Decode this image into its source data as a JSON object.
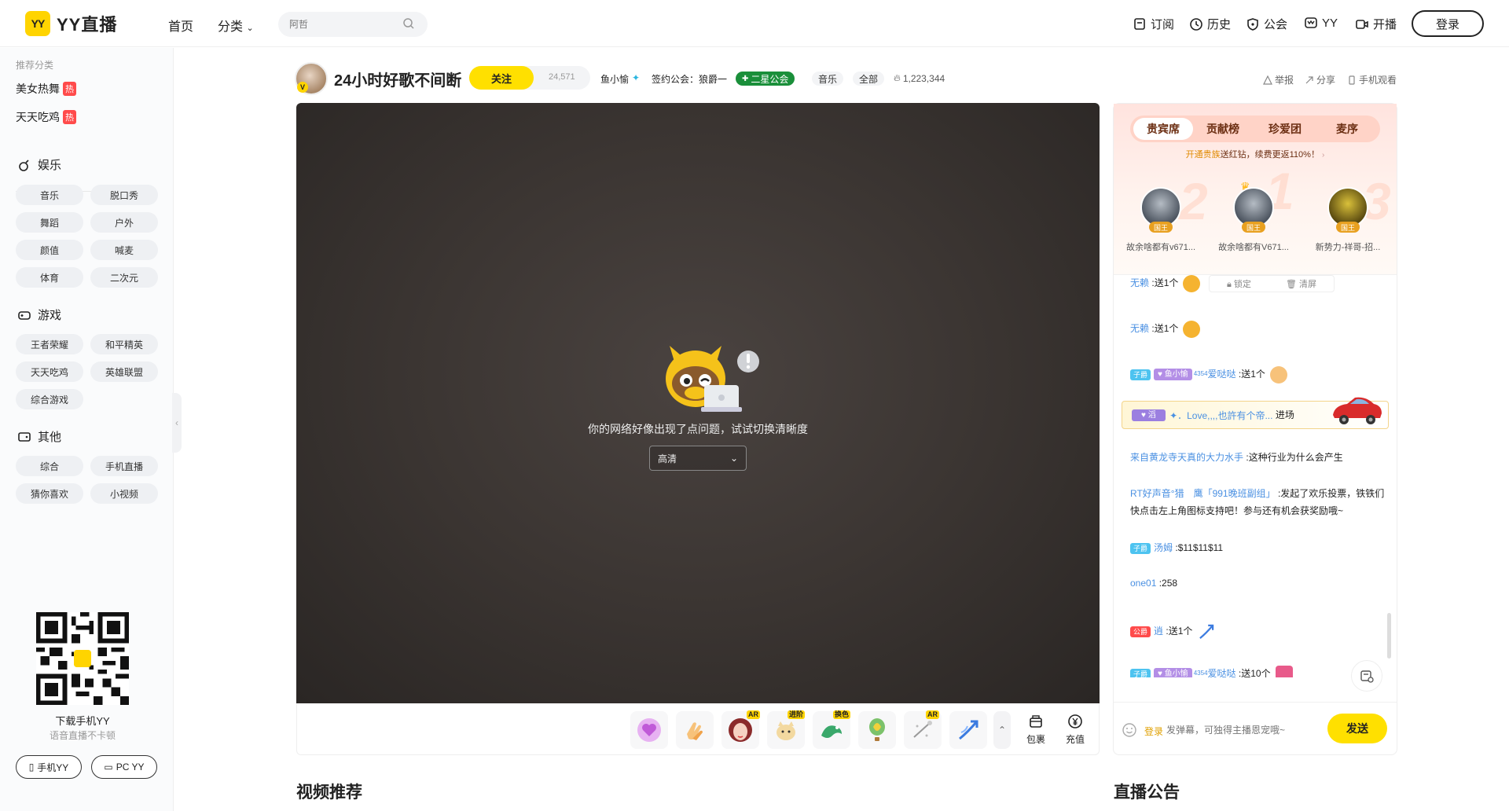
{
  "header": {
    "logo_mark": "YY",
    "logo_text": "YY直播",
    "nav": [
      "首页",
      "分类"
    ],
    "search_placeholder": "阿哲",
    "right_items": [
      "订阅",
      "历史",
      "公会",
      "YY",
      "开播"
    ],
    "login": "登录"
  },
  "sidebar": {
    "recommend_title": "推荐分类",
    "hot_items": [
      {
        "label": "美女热舞",
        "badge": "热"
      },
      {
        "label": "天天吃鸡",
        "badge": "热"
      }
    ],
    "sections": [
      {
        "title": "娱乐",
        "items": [
          "音乐",
          "脱口秀",
          "舞蹈",
          "户外",
          "颜值",
          "喊麦",
          "体育",
          "二次元"
        ]
      },
      {
        "title": "游戏",
        "items": [
          "王者荣耀",
          "和平精英",
          "天天吃鸡",
          "英雄联盟",
          "综合游戏"
        ]
      },
      {
        "title": "其他",
        "items": [
          "综合",
          "手机直播",
          "猜你喜欢",
          "小视频"
        ]
      }
    ],
    "download_title": "下载手机YY",
    "download_sub": "语音直播不卡顿",
    "buttons": [
      "手机YY",
      "PC YY"
    ]
  },
  "room": {
    "title": "24小时好歌不间断",
    "follow": "关注",
    "follow_count": "24,571",
    "anchor": "鱼小愉",
    "guild": "签约公会：狼爵一",
    "guild_tag": "二星公会",
    "tags": [
      "音乐",
      "全部"
    ],
    "heat": "1,223,344",
    "actions": [
      "举报",
      "分享",
      "手机观看"
    ]
  },
  "player": {
    "error": "你的网络好像出现了点问题，试试切换清晰度",
    "quality": "高清"
  },
  "giftbar": {
    "badges": [
      "AR",
      "进阶",
      "换色",
      "AR"
    ],
    "actions": [
      "包裹",
      "充值"
    ]
  },
  "panel": {
    "tabs": [
      "贵宾席",
      "贡献榜",
      "珍爱团",
      "麦序"
    ],
    "promo_highlight": "开通贵族",
    "promo_text": "送红钻，续费更返110%！",
    "rank_numbers": [
      "2",
      "1",
      "3"
    ],
    "rank_badge": "国王",
    "ranks": [
      "故余啥都有v671...",
      "故余啥都有V671...",
      "新势力-祥哥-招..."
    ],
    "lock": "锁定",
    "clear": "清屏",
    "chat": {
      "m1_user": "无赖",
      "m1_text": "送1个",
      "m2_user": "无赖",
      "m2_text": "送1个",
      "m3_level": "子爵",
      "m3_fan": "鱼小愉",
      "m3_num": "4354",
      "m3_user": "爱哒哒",
      "m3_text": "送1个",
      "m4_fan": "滔",
      "m4_user": "✦．Love,,,,也許有个帝...",
      "m4_text": "进场",
      "m5_user": "来自黄龙寺天真的大力水手",
      "m5_text": "这种行业为什么会产生",
      "m6_user": "RT好声音°猎　鹰「991晚班副组」",
      "m6_text": "发起了欢乐投票，铁铁们快点击左上角图标支持吧！参与还有机会获奖励哦~",
      "m7_level": "子爵",
      "m7_user": "汤姆",
      "m7_text": "$11$11$11",
      "m8_user": "one01",
      "m8_text": "258",
      "m9_level": "公爵",
      "m9_user": "逍",
      "m9_text": "送1个",
      "m10_level": "子爵",
      "m10_fan": "鱼小愉",
      "m10_num": "4354",
      "m10_user": "爱哒哒",
      "m10_text": "送10个"
    },
    "input_login": "登录",
    "input_placeholder": "发弹幕，可独得主播恩宠哦~",
    "send": "发送"
  },
  "sections": {
    "video_rec": "视频推荐",
    "notice": "直播公告"
  }
}
